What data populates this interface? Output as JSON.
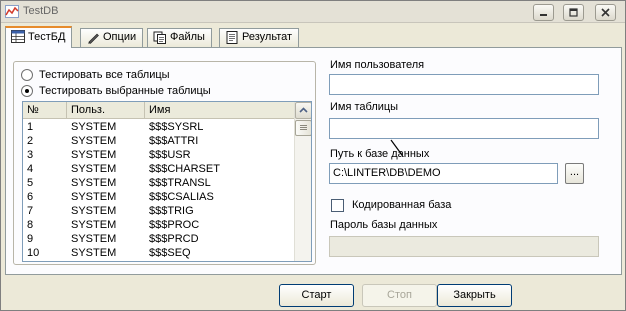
{
  "window": {
    "title": "TestDB",
    "colors": {
      "tab_highlight": "#e68b2c",
      "input_border": "#7f9db9",
      "disabled_bg": "#ebeadf"
    },
    "controls": [
      "minimize-icon",
      "restore-icon",
      "close-icon"
    ]
  },
  "tabs": [
    {
      "label": "ТестБД",
      "icon": "grid-icon",
      "active": true
    },
    {
      "label": "Опции",
      "icon": "pencil-icon",
      "active": false
    },
    {
      "label": "Файлы",
      "icon": "files-icon",
      "active": false
    },
    {
      "label": "Результат",
      "icon": "report-icon",
      "active": false
    }
  ],
  "test_mode": {
    "all_tables": "Тестировать все таблицы",
    "selected_tables": "Тестировать выбранные таблицы",
    "selected": "selected_tables"
  },
  "table_list": {
    "columns": [
      "№",
      "Польз.",
      "Имя"
    ],
    "rows": [
      {
        "num": "1",
        "user": "SYSTEM",
        "name": "$$$SYSRL"
      },
      {
        "num": "2",
        "user": "SYSTEM",
        "name": "$$$ATTRI"
      },
      {
        "num": "3",
        "user": "SYSTEM",
        "name": "$$$USR"
      },
      {
        "num": "4",
        "user": "SYSTEM",
        "name": "$$$CHARSET"
      },
      {
        "num": "5",
        "user": "SYSTEM",
        "name": "$$$TRANSL"
      },
      {
        "num": "6",
        "user": "SYSTEM",
        "name": "$$$CSALIAS"
      },
      {
        "num": "7",
        "user": "SYSTEM",
        "name": "$$$TRIG"
      },
      {
        "num": "8",
        "user": "SYSTEM",
        "name": "$$$PROC"
      },
      {
        "num": "9",
        "user": "SYSTEM",
        "name": "$$$PRCD"
      },
      {
        "num": "10",
        "user": "SYSTEM",
        "name": "$$$SEQ"
      }
    ]
  },
  "form": {
    "username_label": "Имя пользователя",
    "username_value": "",
    "tablename_label": "Имя таблицы",
    "tablename_value": "",
    "db_path_label": "Путь к базе данных",
    "db_path_value": "C:\\LINTER\\DB\\DEMO",
    "browse_label": "...",
    "encrypted_label": "Кодированная база",
    "encrypted_checked": false,
    "db_password_label": "Пароль базы данных",
    "db_password_value": ""
  },
  "buttons": {
    "start": "Старт",
    "stop": "Стоп",
    "close": "Закрыть"
  }
}
